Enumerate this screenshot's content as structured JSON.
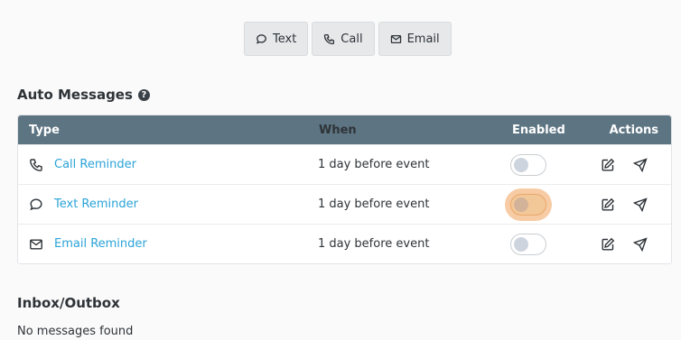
{
  "compose": {
    "text_label": "Text",
    "call_label": "Call",
    "email_label": "Email"
  },
  "auto_messages": {
    "title": "Auto Messages",
    "help_glyph": "?",
    "columns": {
      "type": "Type",
      "when": "When",
      "enabled": "Enabled",
      "actions": "Actions"
    },
    "rows": [
      {
        "icon": "phone-icon",
        "type": "Call Reminder",
        "when": "1 day before event",
        "enabled": false
      },
      {
        "icon": "chat-bubble-icon",
        "type": "Text Reminder",
        "when": "1 day before event",
        "enabled": false
      },
      {
        "icon": "envelope-icon",
        "type": "Email Reminder",
        "when": "1 day before event",
        "enabled": false
      }
    ]
  },
  "inbox": {
    "title": "Inbox/Outbox",
    "empty_text": "No messages found"
  },
  "colors": {
    "header_bg": "#5d7482",
    "link": "#2aa3d8",
    "focus_ring": "#f0a05a"
  }
}
